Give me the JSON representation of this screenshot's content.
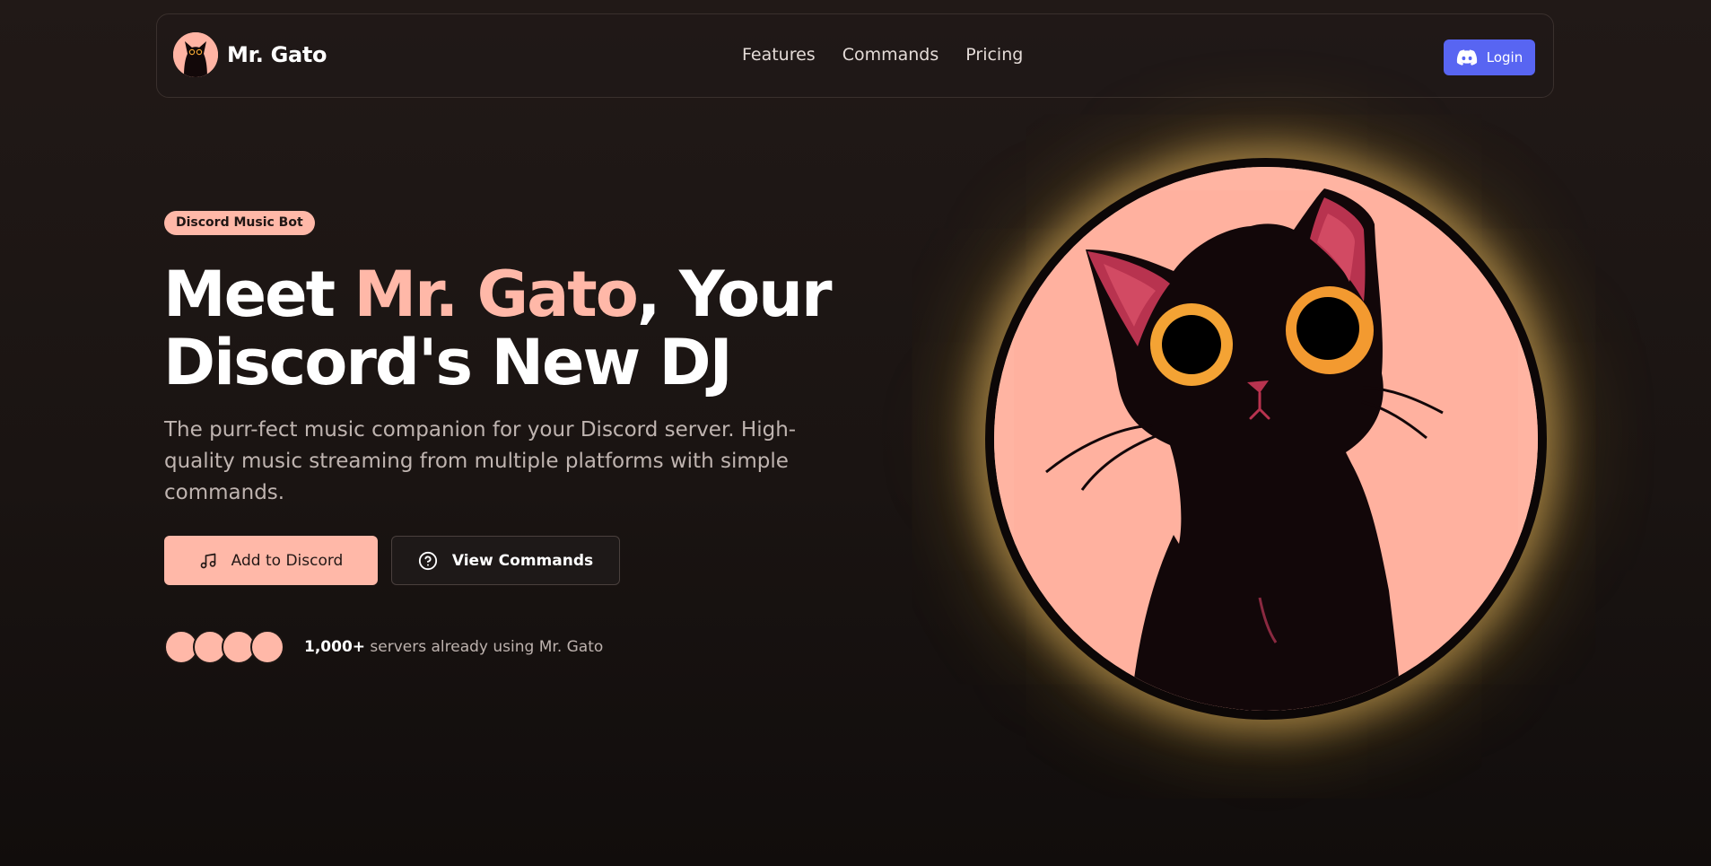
{
  "nav": {
    "brand": "Mr. Gato",
    "links": [
      "Features",
      "Commands",
      "Pricing"
    ],
    "login_label": "Login"
  },
  "hero": {
    "badge": "Discord Music Bot",
    "headline": {
      "part1": "Meet ",
      "accent": "Mr. Gato",
      "part2": ", Your",
      "line2": "Discord's New DJ"
    },
    "subtitle": "The purr-fect music companion for your Discord server. High-quality music streaming from multiple platforms with simple commands.",
    "primary_button": "Add to Discord",
    "secondary_button": "View Commands",
    "social_proof": {
      "count": "1,000+",
      "text": " servers already using Mr. Gato"
    }
  },
  "icons": {
    "brand_logo": "cat-avatar-icon",
    "login": "discord-icon",
    "primary": "music-note-icon",
    "secondary": "question-circle-icon",
    "hero": "black-cat-illustration"
  },
  "colors": {
    "accent": "#ffb8a8",
    "discord": "#5865f2",
    "background": "#1a1412",
    "glow": "#f0c35a"
  }
}
